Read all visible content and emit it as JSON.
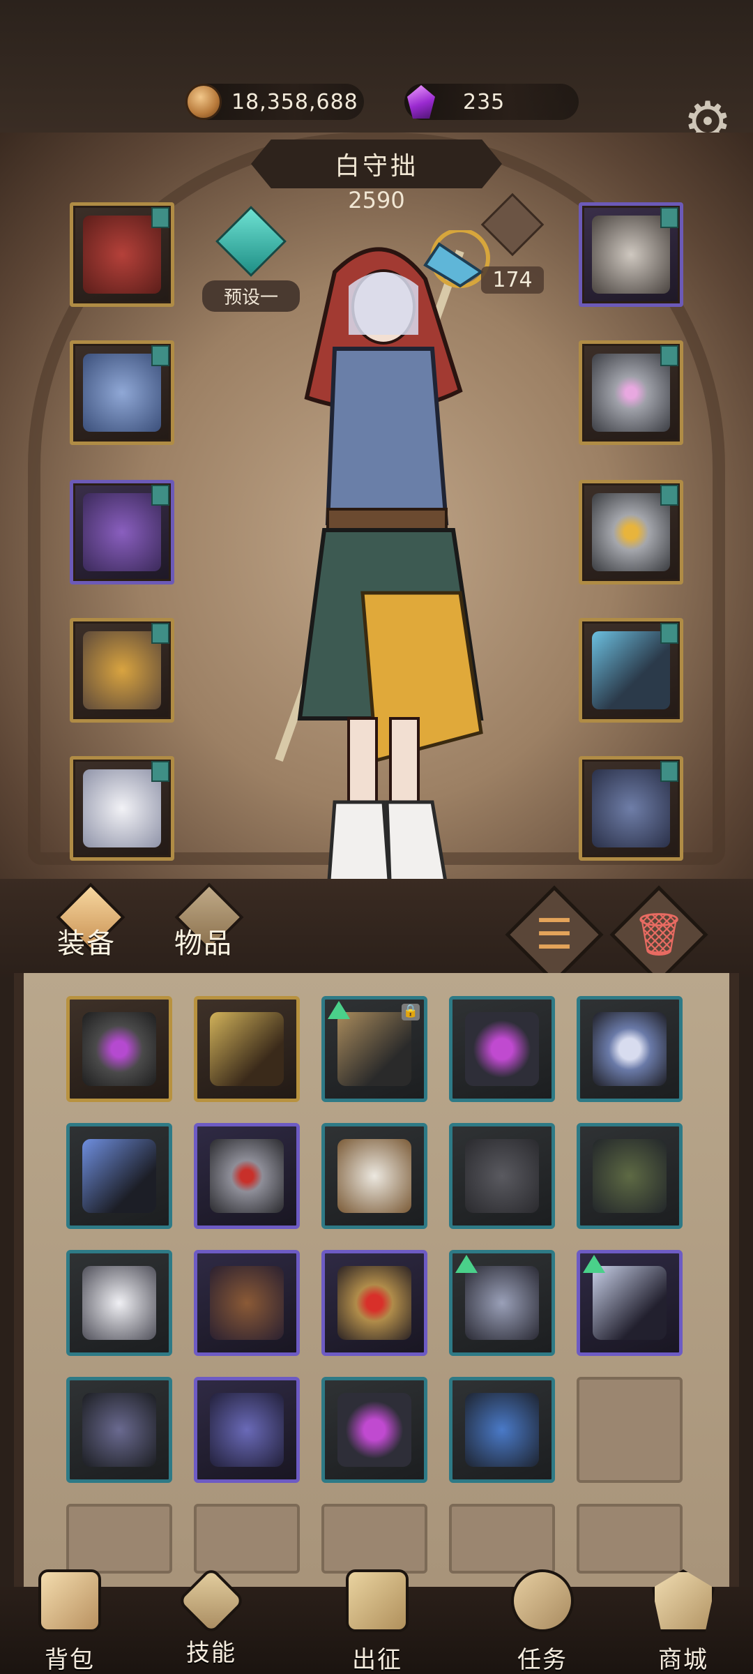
{
  "resources": {
    "gold": "18,358,688",
    "gems": "235"
  },
  "character": {
    "name": "白守拙",
    "power": "2590",
    "preset_label": "预设一",
    "stat_value": "174"
  },
  "equipment_slots": {
    "left": [
      "hood-icon",
      "armor-icon",
      "glove-icon",
      "belt-icon",
      "boots-icon"
    ],
    "right": [
      "helmet-icon",
      "ring-icon",
      "ring-icon",
      "staff-icon",
      "shoulder-icon"
    ]
  },
  "tabs": {
    "equip": "装备",
    "items": "物品"
  },
  "inventory": [
    {
      "icon": "amulet-icon",
      "rarity": "gold"
    },
    {
      "icon": "wand-icon",
      "rarity": "gold"
    },
    {
      "icon": "branch-staff-icon",
      "rarity": "teal",
      "upgrade": true,
      "locked": true
    },
    {
      "icon": "gauntlet-icon",
      "rarity": "teal"
    },
    {
      "icon": "mirror-staff-icon",
      "rarity": "teal"
    },
    {
      "icon": "scepter-icon",
      "rarity": "teal"
    },
    {
      "icon": "ring-icon",
      "rarity": "purple"
    },
    {
      "icon": "coat-icon",
      "rarity": "teal"
    },
    {
      "icon": "robe-icon",
      "rarity": "teal"
    },
    {
      "icon": "pants-icon",
      "rarity": "teal"
    },
    {
      "icon": "glove-icon",
      "rarity": "teal"
    },
    {
      "icon": "boots-icon",
      "rarity": "purple"
    },
    {
      "icon": "eye-ring-icon",
      "rarity": "purple"
    },
    {
      "icon": "wolf-helm-icon",
      "rarity": "teal",
      "upgrade": true
    },
    {
      "icon": "spear-icon",
      "rarity": "purple",
      "upgrade": true
    },
    {
      "icon": "necklace-icon",
      "rarity": "teal"
    },
    {
      "icon": "skirt-icon",
      "rarity": "purple"
    },
    {
      "icon": "gauntlet-icon",
      "rarity": "teal"
    },
    {
      "icon": "book-icon",
      "rarity": "teal"
    },
    {
      "icon": "",
      "rarity": "empty"
    }
  ],
  "nav": {
    "bag": "背包",
    "skills": "技能",
    "expedition": "出征",
    "tasks": "任务",
    "shop": "商城"
  },
  "colors": {
    "gold_frame": "#b8923f",
    "teal_frame": "#2e7a86",
    "purple_frame": "#6d5bc4",
    "upgrade_arrow": "#4ad08a",
    "panel": "#b9a78c"
  }
}
